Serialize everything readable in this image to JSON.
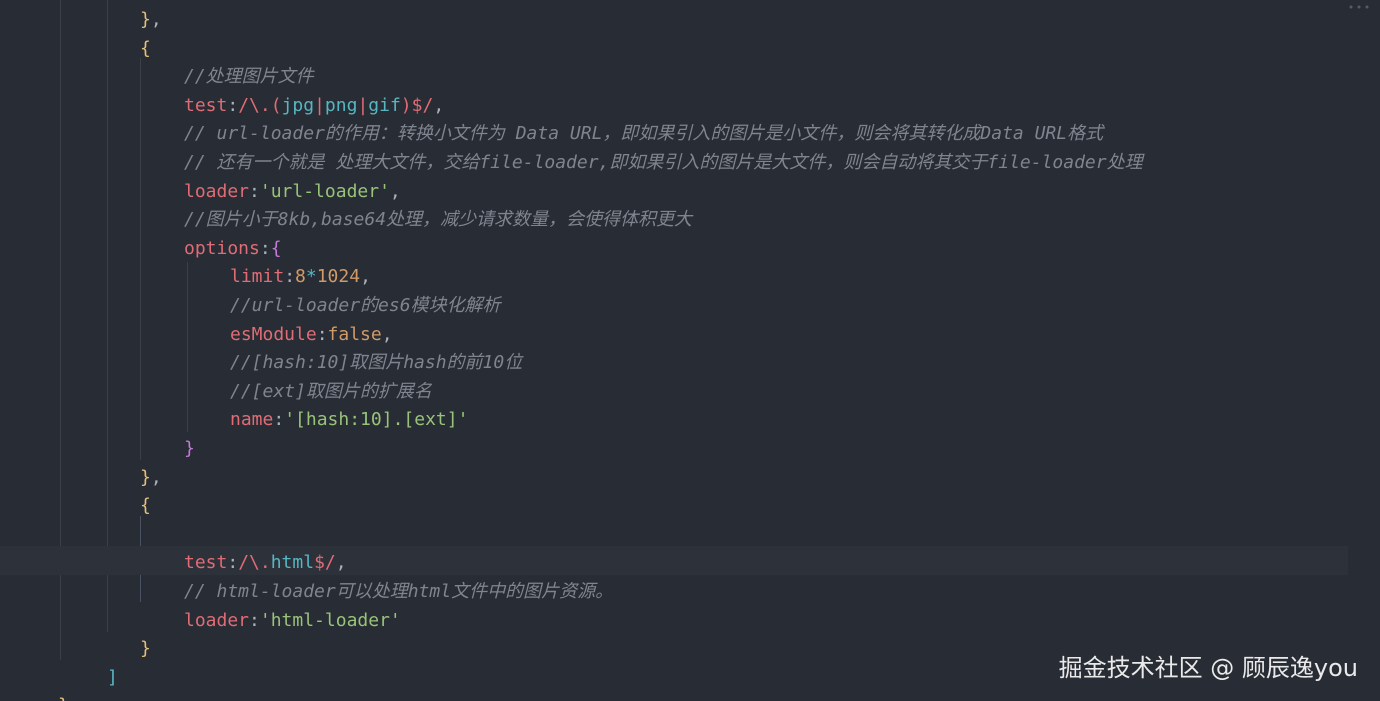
{
  "editor": {
    "lines": [
      {
        "id": "l1",
        "segments": [
          [
            "}",
            "brace1"
          ],
          [
            ",",
            "punct"
          ]
        ]
      },
      {
        "id": "l2",
        "segments": [
          [
            "{",
            "brace1"
          ]
        ]
      },
      {
        "id": "l3",
        "segments": [
          [
            "//处理图片文件",
            "comment"
          ]
        ]
      },
      {
        "id": "l4",
        "segments": [
          [
            "test",
            "key"
          ],
          [
            ":",
            "punct"
          ],
          [
            "/\\.(",
            "regex"
          ],
          [
            "jpg",
            "regex2"
          ],
          [
            "|",
            "regex"
          ],
          [
            "png",
            "regex2"
          ],
          [
            "|",
            "regex"
          ],
          [
            "gif",
            "regex2"
          ],
          [
            ")$/",
            "regex"
          ],
          [
            ",",
            "punct"
          ]
        ]
      },
      {
        "id": "l5",
        "segments": [
          [
            "// url-loader的作用：转换小文件为 Data URL，即如果引入的图片是小文件，则会将其转化成Data URL格式",
            "comment"
          ]
        ]
      },
      {
        "id": "l6",
        "segments": [
          [
            "// 还有一个就是 处理大文件，交给file-loader,即如果引入的图片是大文件，则会自动将其交于file-loader处理",
            "comment"
          ]
        ]
      },
      {
        "id": "l7",
        "segments": [
          [
            "loader",
            "key"
          ],
          [
            ":",
            "punct"
          ],
          [
            "'url-loader'",
            "str"
          ],
          [
            ",",
            "punct"
          ]
        ]
      },
      {
        "id": "l8",
        "segments": [
          [
            "//图片小于8kb,base64处理，减少请求数量，会使得体积更大",
            "comment"
          ]
        ]
      },
      {
        "id": "l9",
        "segments": [
          [
            "options",
            "key"
          ],
          [
            ":",
            "punct"
          ],
          [
            "{",
            "brace2"
          ]
        ]
      },
      {
        "id": "l10",
        "segments": [
          [
            "limit",
            "key"
          ],
          [
            ":",
            "punct"
          ],
          [
            "8",
            "num"
          ],
          [
            "*",
            "op"
          ],
          [
            "1024",
            "num"
          ],
          [
            ",",
            "punct"
          ]
        ]
      },
      {
        "id": "l11",
        "segments": [
          [
            "//url-loader的es6模块化解析",
            "comment"
          ]
        ]
      },
      {
        "id": "l12",
        "segments": [
          [
            "esModule",
            "key"
          ],
          [
            ":",
            "punct"
          ],
          [
            "false",
            "bool"
          ],
          [
            ",",
            "punct"
          ]
        ]
      },
      {
        "id": "l13",
        "segments": [
          [
            "//[hash:10]取图片hash的前10位",
            "comment"
          ]
        ]
      },
      {
        "id": "l14",
        "segments": [
          [
            "//[ext]取图片的扩展名",
            "comment"
          ]
        ]
      },
      {
        "id": "l15",
        "segments": [
          [
            "name",
            "key"
          ],
          [
            ":",
            "punct"
          ],
          [
            "'[hash:10].[ext]'",
            "str"
          ]
        ]
      },
      {
        "id": "l16",
        "segments": [
          [
            "}",
            "brace2"
          ]
        ]
      },
      {
        "id": "l17",
        "segments": [
          [
            "}",
            "brace1"
          ],
          [
            ",",
            "punct"
          ]
        ]
      },
      {
        "id": "l18",
        "segments": [
          [
            "{",
            "brace1"
          ]
        ]
      },
      {
        "id": "l19",
        "segments": [
          [
            "",
            "punct"
          ]
        ]
      },
      {
        "id": "l20",
        "segments": [
          [
            "test",
            "key"
          ],
          [
            ":",
            "punct"
          ],
          [
            "/\\.",
            "regex"
          ],
          [
            "html",
            "regex2"
          ],
          [
            "$/",
            "regex"
          ],
          [
            ",",
            "punct"
          ]
        ]
      },
      {
        "id": "l21",
        "segments": [
          [
            "// html-loader可以处理html文件中的图片资源。",
            "comment"
          ]
        ]
      },
      {
        "id": "l22",
        "segments": [
          [
            "loader",
            "key"
          ],
          [
            ":",
            "punct"
          ],
          [
            "'html-loader'",
            "str"
          ]
        ]
      },
      {
        "id": "l23",
        "segments": [
          [
            "}",
            "brace1"
          ]
        ]
      },
      {
        "id": "l24",
        "segments": [
          [
            "]",
            "brace3"
          ]
        ]
      },
      {
        "id": "l25",
        "segments": [
          [
            "}",
            "brace1"
          ],
          [
            ",",
            "punct"
          ]
        ]
      }
    ]
  },
  "watermark": {
    "text": "掘金技术社区 @ 顾辰逸you"
  },
  "colors": {
    "background": "#282c34",
    "comment": "#7f848e",
    "key": "#e06c75",
    "string": "#98c379",
    "number": "#d19a66",
    "regex_group": "#56b6c2",
    "brace_outer": "#e5c07b",
    "brace_inner": "#c678dd"
  }
}
